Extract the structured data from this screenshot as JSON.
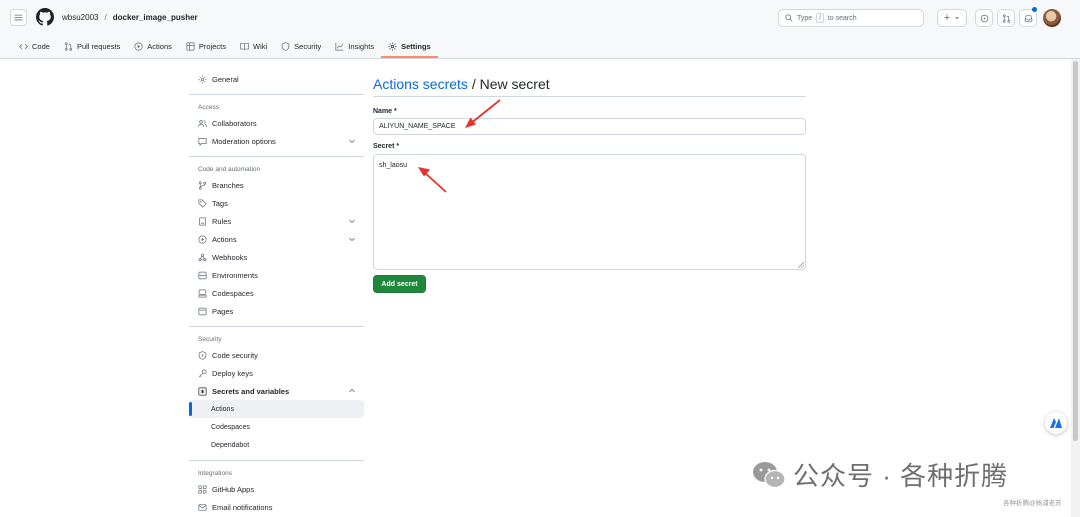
{
  "header": {
    "owner": "wbsu2003",
    "separator": "/",
    "repo": "docker_image_pusher",
    "search_prefix": "Type",
    "search_key": "/",
    "search_suffix": "to search",
    "plus_symbol": "+"
  },
  "tabs": [
    {
      "label": "Code",
      "icon": "code-icon"
    },
    {
      "label": "Pull requests",
      "icon": "pull-request-icon"
    },
    {
      "label": "Actions",
      "icon": "play-icon"
    },
    {
      "label": "Projects",
      "icon": "table-icon"
    },
    {
      "label": "Wiki",
      "icon": "book-icon"
    },
    {
      "label": "Security",
      "icon": "shield-icon"
    },
    {
      "label": "Insights",
      "icon": "graph-icon"
    },
    {
      "label": "Settings",
      "icon": "gear-icon",
      "selected": true
    }
  ],
  "sidebar": {
    "general": "General",
    "access_heading": "Access",
    "collaborators": "Collaborators",
    "moderation": "Moderation options",
    "code_heading": "Code and automation",
    "branches": "Branches",
    "tags": "Tags",
    "rules": "Rules",
    "actions": "Actions",
    "webhooks": "Webhooks",
    "environments": "Environments",
    "codespaces": "Codespaces",
    "pages": "Pages",
    "security_heading": "Security",
    "code_security": "Code security",
    "deploy_keys": "Deploy keys",
    "secrets_vars": "Secrets and variables",
    "sub_actions": "Actions",
    "sub_codespaces": "Codespaces",
    "sub_dependabot": "Dependabot",
    "integrations_heading": "Integrations",
    "github_apps": "GitHub Apps",
    "email_notifications": "Email notifications"
  },
  "main": {
    "title_link": "Actions secrets",
    "title_rest": " / New secret",
    "name_label": "Name *",
    "name_value": "ALIYUN_NAME_SPACE",
    "secret_label": "Secret *",
    "secret_value": "sh_laosu",
    "add_button": "Add secret"
  },
  "watermark": {
    "text": "公众号 · 各种折腾",
    "small": "各种折腾@杨浦老苏"
  },
  "colors": {
    "accent": "#0969da",
    "primary_button": "#1f883d",
    "tab_underline": "#fd8c73",
    "annotation_arrow": "#e8322b"
  }
}
